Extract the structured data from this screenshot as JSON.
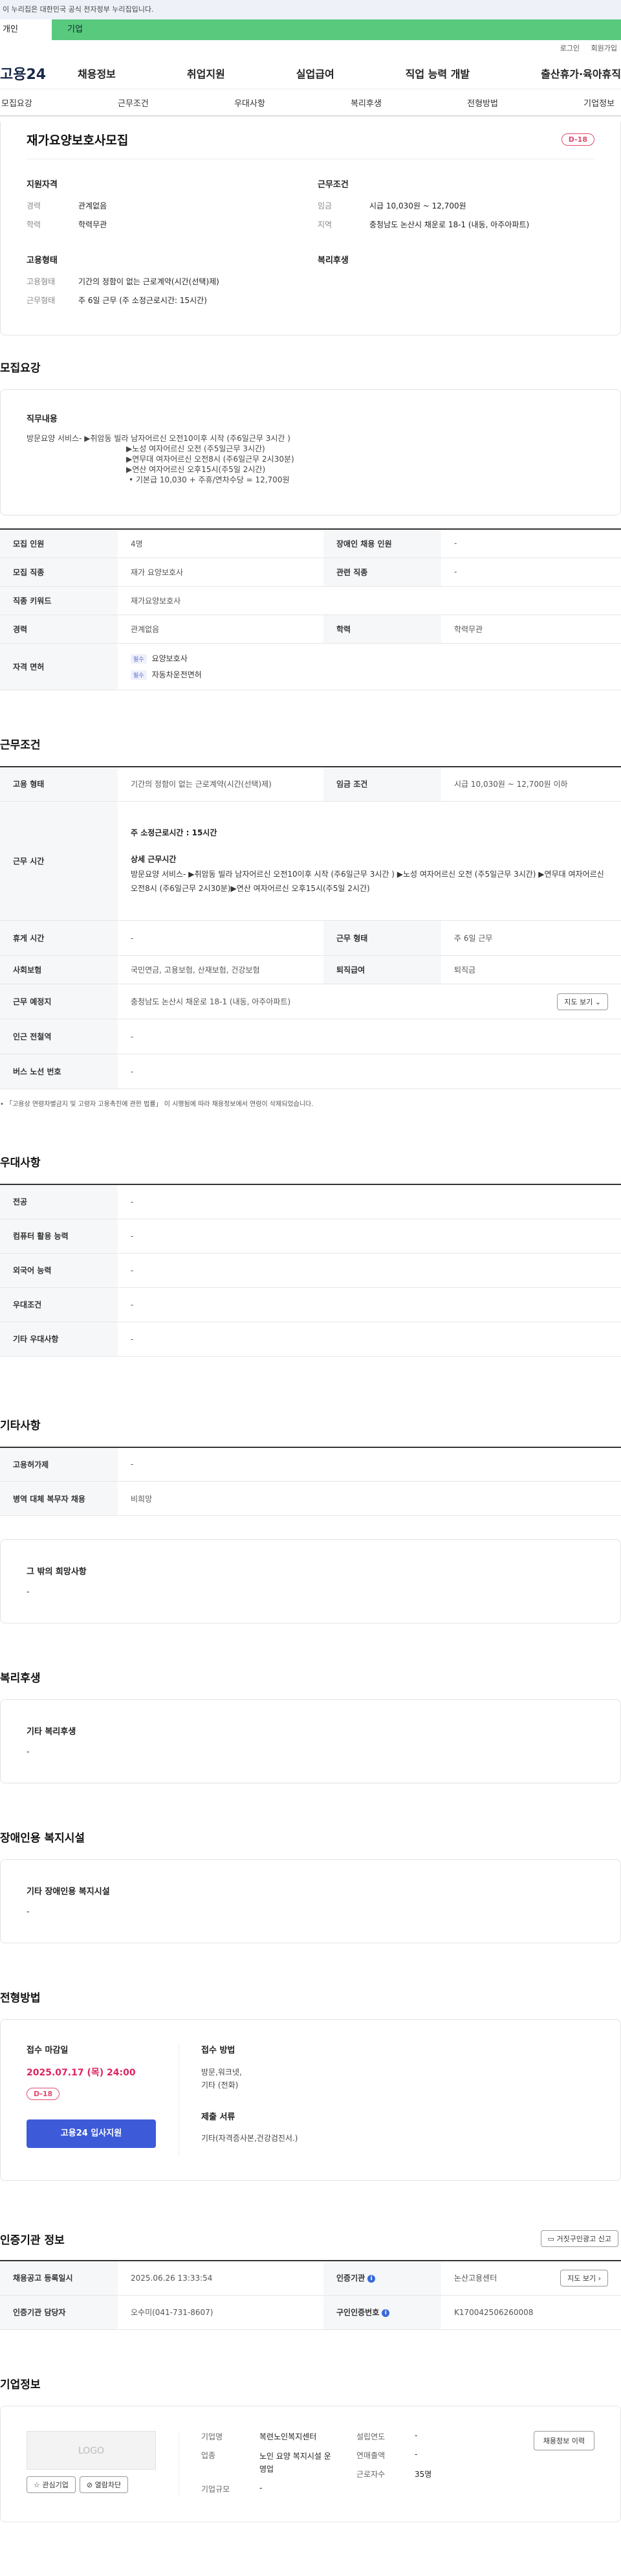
{
  "gov_bar": "이 누리집은 대한민국 공식 전자정부 누리집입니다.",
  "audience": {
    "person": "개인",
    "business": "기업"
  },
  "util": {
    "login": "로그인",
    "signup": "회원가입"
  },
  "gnb": {
    "logo": "고용24",
    "menu": [
      "채용정보",
      "취업지원",
      "실업급여",
      "직업 능력 개발",
      "출산휴가·육아휴직"
    ]
  },
  "tabs": [
    "모집요강",
    "근무조건",
    "우대사항",
    "복리후생",
    "전형방법",
    "기업정보"
  ],
  "summary": {
    "title": "재가요양보호사모집",
    "dday": "D-18",
    "qualification_title": "지원자격",
    "career_label": "경력",
    "career_value": "관계없음",
    "education_label": "학력",
    "education_value": "학력무관",
    "conditions_title": "근무조건",
    "wage_label": "임금",
    "wage_value": "시급 10,030원 ~ 12,700원",
    "region_label": "지역",
    "region_value": "충청남도 논산시 채운로 18-1 (내동, 아주아파트)",
    "employment_title": "고용형태",
    "emptype_label": "고용형태",
    "emptype_value": "기간의 정함이 없는 근로계약(시간(선택)제)",
    "worktype_label": "근무형태",
    "worktype_value": "주 6일 근무 (주 소정근로시간: 15시간)",
    "welfare_title": "복리후생"
  },
  "recruit": {
    "section_title": "모집요강",
    "duty_title": "직무내용",
    "duty_lines": [
      "방문요양 서비스- ▶취암동 빌라 남자어르신 오전10이후 시작 (주6일근무 3시간 )",
      "▶노성 여자어르신  오전 (주5일근무 3시간)",
      "▶연무대 여자어르신 오전8시 (주6일근무 2시30분)",
      "▶연산 여자어르신 오후15시(주5일 2시간)",
      " • 기본급 10,030 + 주휴/연차수당 = 12,700원"
    ],
    "rows": [
      {
        "h1": "모집 인원",
        "v1": "4명",
        "h2": "장애인 채용 인원",
        "v2": "-"
      },
      {
        "h1": "모집 직종",
        "v1": "재가 요양보호사",
        "h2": "관련 직종",
        "v2": "-"
      },
      {
        "h1": "직종 키워드",
        "v1": "재가요양보호사"
      },
      {
        "h1": "경력",
        "v1": "관계없음",
        "h2": "학력",
        "v2": "학력무관"
      }
    ],
    "license_label": "자격 면허",
    "license_tag": "필수",
    "licenses": [
      "요양보호사",
      "자동차운전면허"
    ]
  },
  "conditions": {
    "section_title": "근무조건",
    "emptype_label": "고용 형태",
    "emptype_value": "기간의 정함이 없는 근로계약(시간(선택)제)",
    "wage_label": "임금 조건",
    "wage_value": "시급 10,030원 ~ 12,700원 이하",
    "hours_label": "근무 시간",
    "hours_weekly": "주 소정근로시간 : 15시간",
    "hours_detail_title": "상세 근무시간",
    "hours_detail": "방문요양 서비스- ▶취암동 빌라 남자어르신 오전10이후 시작 (주6일근무 3시간 )    ▶노성 여자어르신  오전 (주5일근무 3시간)    ▶연무대 여자어르신 오전8시 (주6일근무 2시30분)▶연산 여자어르신 오후15시(주5일 2시간)",
    "rest_label": "휴게 시간",
    "rest_value": "-",
    "worktype_label": "근무 형태",
    "worktype_value": "주 6일 근무",
    "insurance_label": "사회보험",
    "insurance_value": "국민연금, 고용보험, 산재보험, 건강보험",
    "severance_label": "퇴직급여",
    "severance_value": "퇴직금",
    "location_label": "근무 예정지",
    "location_value": "충청남도 논산시 채운로 18-1 (내동, 아주아파트)",
    "map_button": "지도 보기",
    "station_label": "인근 전철역",
    "station_value": "-",
    "bus_label": "버스 노선 번호",
    "bus_value": "-",
    "note": "「고용상 연령차별금지 및 고령자 고용촉진에 관한 법률」 이 시행됨에 따라 채용정보에서 연령이 삭제되었습니다."
  },
  "preference": {
    "section_title": "우대사항",
    "rows": [
      {
        "h": "전공",
        "v": "-"
      },
      {
        "h": "컴퓨터 활용 능력",
        "v": "-"
      },
      {
        "h": "외국어 능력",
        "v": "-"
      },
      {
        "h": "우대조건",
        "v": "-"
      },
      {
        "h": "기타 우대사항",
        "v": "-"
      }
    ]
  },
  "etc": {
    "section_title": "기타사항",
    "rows": [
      {
        "h": "고용허가제",
        "v": "-"
      },
      {
        "h": "병역 대체 복무자 채용",
        "v": "비희망"
      }
    ],
    "other_title": "그 밖의 희망사항",
    "other_value": "-"
  },
  "welfare": {
    "section_title": "복리후생",
    "box_title": "기타 복리후생",
    "box_value": "-"
  },
  "disability": {
    "section_title": "장애인용 복지시설",
    "box_title": "기타 장애인용 복지시설",
    "box_value": "-"
  },
  "selection": {
    "section_title": "전형방법",
    "deadline_label": "접수 마감일",
    "deadline_value": "2025.07.17 (목) 24:00",
    "dday": "D-18",
    "apply_button": "고용24 입사지원",
    "method_label": "접수 방법",
    "method_value": "방문,워크넷,\n기타 (전화)",
    "docs_label": "제출 서류",
    "docs_value": "기타(자격증사본,건강검진서.)"
  },
  "cert": {
    "section_title": "인증기관 정보",
    "report_button": "거짓구인광고 신고",
    "posted_label": "채용공고 등록일시",
    "posted_value": "2025.06.26 13:33:54",
    "agency_label": "인증기관",
    "agency_value": "논산고용센터",
    "map_button": "지도 보기",
    "manager_label": "인증기관 담당자",
    "manager_value": "오수미(041-731-8607)",
    "number_label": "구인인증번호",
    "number_value": "K170042506260008"
  },
  "company": {
    "section_title": "기업정보",
    "logo_text": "LOGO",
    "fav_button": "관심기업",
    "block_button": "열람차단",
    "name_label": "기업명",
    "name_value": "복련노인복지센터",
    "industry_label": "업종",
    "industry_value": "노인 요양 복지시설 운영업",
    "size_label": "기업규모",
    "size_value": "-",
    "founded_label": "설립연도",
    "founded_value": "-",
    "sales_label": "연매출액",
    "sales_value": "-",
    "employees_label": "근로자수",
    "employees_value": "35명",
    "history_button": "채용정보 이력"
  }
}
